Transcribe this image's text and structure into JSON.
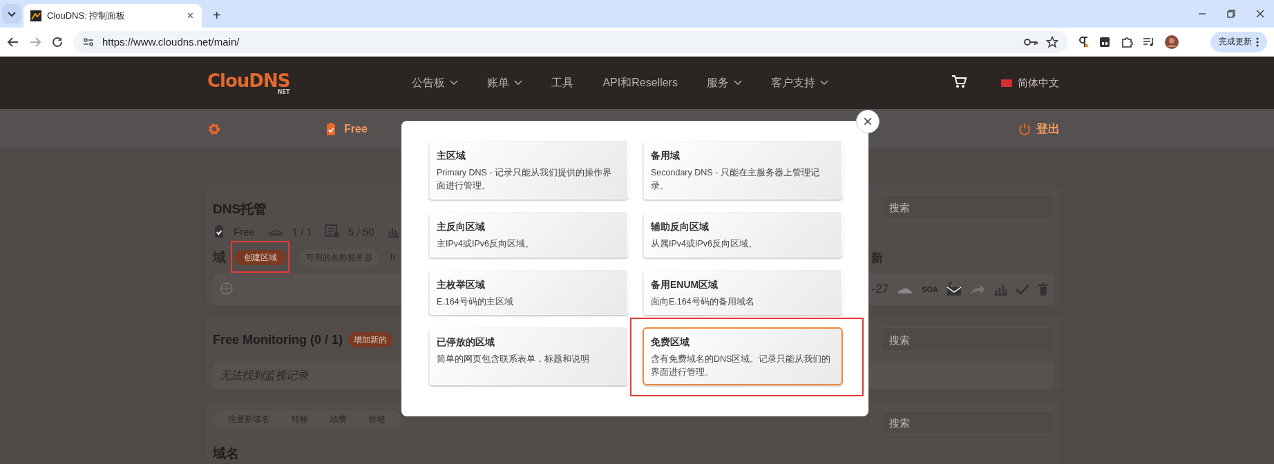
{
  "browser": {
    "tab": {
      "title": "ClouDNS: 控制面板",
      "close": "×"
    },
    "new_tab": "+",
    "address": "https://www.cloudns.net/main/",
    "update_button": "完成更新"
  },
  "header": {
    "logo": "ClouDNS",
    "logo_sub": "NET",
    "nav": [
      {
        "label": "公告板",
        "dropdown": true
      },
      {
        "label": "账单",
        "dropdown": true
      },
      {
        "label": "工具",
        "dropdown": false
      },
      {
        "label": "API和Resellers",
        "dropdown": false
      },
      {
        "label": "服务",
        "dropdown": true
      },
      {
        "label": "客户支持",
        "dropdown": true
      }
    ],
    "language": "简体中文"
  },
  "subheader": {
    "plan": "Free",
    "logout": "登出"
  },
  "dns_hosting": {
    "title": "DNS托管",
    "stats": [
      {
        "kind": "plan",
        "text": "Free"
      },
      {
        "kind": "zones",
        "text": "1 / 1"
      },
      {
        "kind": "records",
        "text": "5 / 50"
      },
      {
        "kind": "chart"
      }
    ],
    "section_label": "域",
    "create_button": "创建区域",
    "tabs": [
      "可用的名称服务器",
      "b"
    ],
    "search_placeholder": "搜索",
    "column_heading": "新",
    "zone_row": {
      "date": "-27",
      "actions": [
        {
          "kind": "cloud"
        },
        {
          "kind": "text",
          "text": "SOA"
        },
        {
          "kind": "mail"
        },
        {
          "kind": "share"
        },
        {
          "kind": "chart"
        },
        {
          "kind": "check"
        },
        {
          "kind": "trash"
        }
      ]
    }
  },
  "monitoring": {
    "title": "Free Monitoring (0 / 1)",
    "add_button": "增加新的",
    "search_placeholder": "搜索",
    "empty": "无法找到监视记录"
  },
  "domains": {
    "tabs": [
      "注册新域名",
      "转移",
      "续费",
      "价格"
    ],
    "title": "域名",
    "search_placeholder": "搜索"
  },
  "modal": {
    "close": "×",
    "options": [
      {
        "title": "主区域",
        "description": "Primary DNS - 记录只能从我们提供的操作界面进行管理。",
        "selected": false
      },
      {
        "title": "备用域",
        "description": "Secondary DNS - 只能在主服务器上管理记录。",
        "selected": false
      },
      {
        "title": "主反向区域",
        "description": "主IPv4或IPv6反向区域。",
        "selected": false
      },
      {
        "title": "辅助反向区域",
        "description": "从属IPv4或IPv6反向区域。",
        "selected": false
      },
      {
        "title": "主枚举区域",
        "description": "E.164号码的主区域",
        "selected": false
      },
      {
        "title": "备用ENUM区域",
        "description": "面向E.164号码的备用域名",
        "selected": false
      },
      {
        "title": "已停放的区域",
        "description": "简单的网页包含联系表单，标题和说明",
        "selected": false
      },
      {
        "title": "免费区域",
        "description": "含有免费域名的DNS区域。记录只能从我们的界面进行管理。",
        "selected": true
      }
    ]
  }
}
